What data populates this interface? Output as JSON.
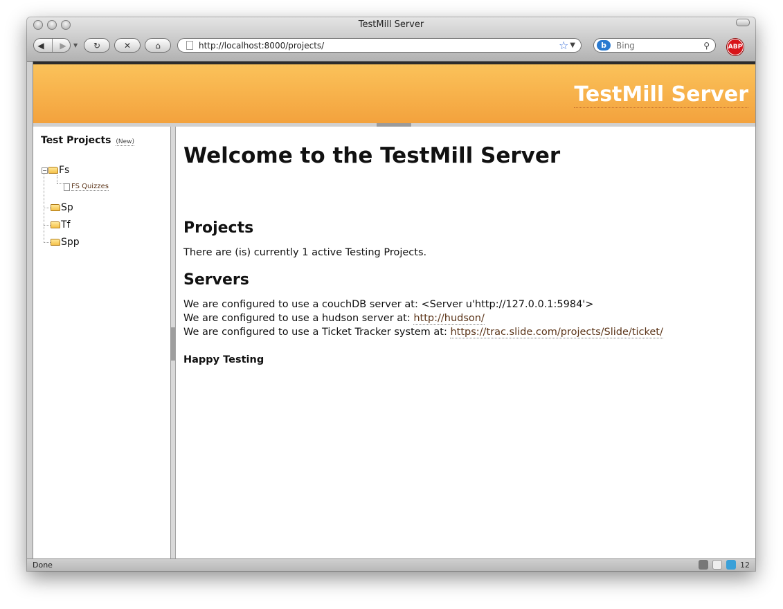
{
  "window": {
    "title": "TestMill Server"
  },
  "toolbar": {
    "url": "http://localhost:8000/projects/",
    "search_placeholder": "Bing",
    "abp_label": "ABP"
  },
  "banner": {
    "title": "TestMill Server"
  },
  "sidebar": {
    "title": "Test Projects",
    "new_link": "(New)",
    "tree": [
      {
        "label": "Fs",
        "expanded": true,
        "children": [
          {
            "label": "FS Quizzes"
          }
        ]
      },
      {
        "label": "Sp"
      },
      {
        "label": "Tf"
      },
      {
        "label": "Spp"
      }
    ]
  },
  "main": {
    "heading": "Welcome to the TestMill Server",
    "projects_heading": "Projects",
    "projects_text": "There are (is) currently 1 active Testing Projects.",
    "servers_heading": "Servers",
    "couchdb_text": "We are configured to use a couchDB server at: <Server u'http://127.0.0.1:5984'>",
    "hudson_text": "We are configured to use a hudson server at:",
    "hudson_link": "http://hudson/",
    "ticket_text": "We are configured to use a Ticket Tracker system at:",
    "ticket_link": "https://trac.slide.com/projects/Slide/ticket/",
    "closing": "Happy Testing"
  },
  "status": {
    "text": "Done",
    "yslow_count": "12"
  },
  "icons": [
    "back-icon",
    "forward-icon",
    "reload-icon",
    "stop-icon",
    "home-icon",
    "page-icon",
    "bookmark-star-icon",
    "bing-icon",
    "search-icon",
    "adblock-icon",
    "firebug-icon",
    "twitter-icon",
    "yslow-icon",
    "folder-icon",
    "document-icon"
  ]
}
